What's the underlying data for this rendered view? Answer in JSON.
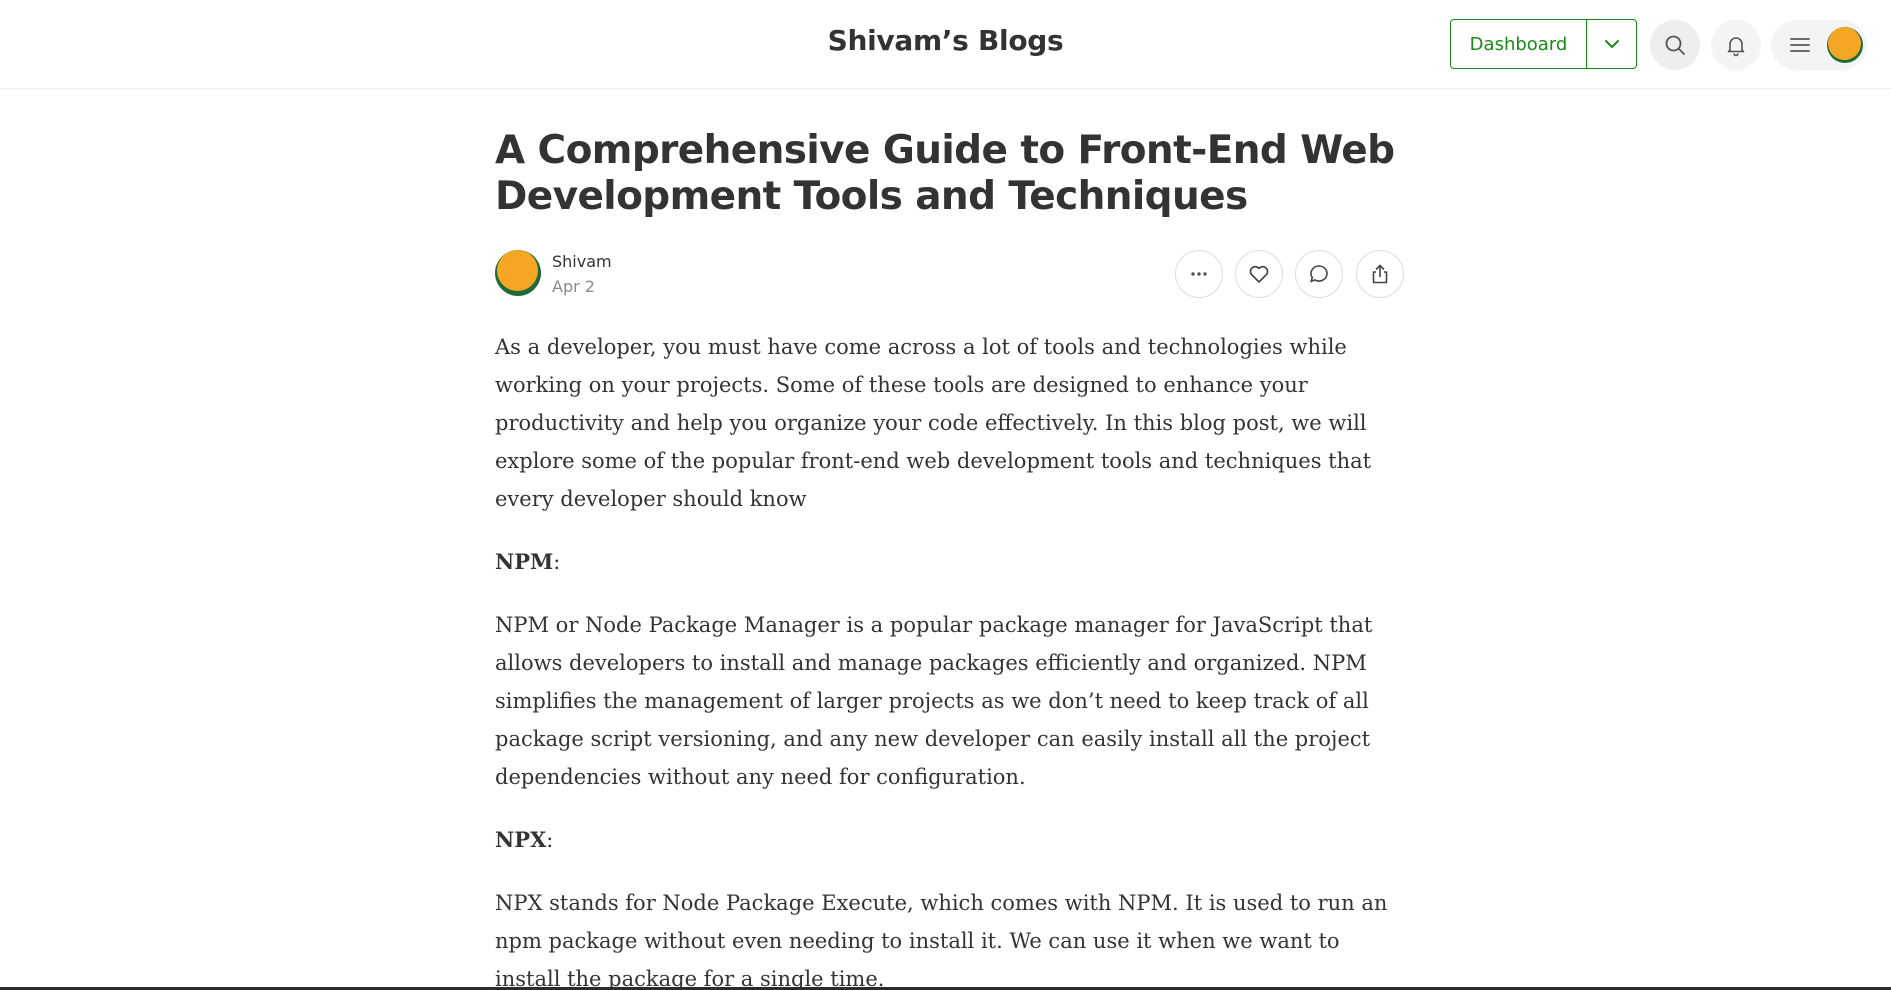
{
  "header": {
    "blog_title": "Shivam’s Blogs",
    "dashboard_label": "Dashboard",
    "accent_color": "#1a8917"
  },
  "article": {
    "title": "A Comprehensive Guide to Front-End Web Development Tools and Techniques",
    "author": "Shivam",
    "date": "Apr 2",
    "paragraphs": [
      {
        "kind": "text",
        "text": "As a developer, you must have come across a lot of tools and technologies while working on your projects. Some of these tools are designed to enhance your productivity and help you organize your code effectively. In this blog post, we will explore some of the popular front-end web development tools and techniques that every developer should know"
      },
      {
        "kind": "heading",
        "strong": "NPM",
        "rest": ":"
      },
      {
        "kind": "text",
        "text": "NPM or Node Package Manager is a popular package manager for JavaScript that allows developers to install and manage packages efficiently and organized. NPM simplifies the management of larger projects as we don’t need to keep track of all package script versioning, and any new developer can easily install all the project dependencies without any need for configuration."
      },
      {
        "kind": "heading",
        "strong": "NPX",
        "rest": ":"
      },
      {
        "kind": "text",
        "text": "NPX stands for Node Package Execute, which comes with NPM. It is used to run an npm package without even needing to install it. We can use it when we want to install the package for a single time."
      }
    ]
  },
  "icons": {
    "dashboard_caret": "chevron-down-icon",
    "search": "search-icon",
    "notifications": "bell-icon",
    "menu": "hamburger-icon",
    "more": "more-horizontal-icon",
    "like": "heart-icon",
    "comment": "comment-icon",
    "share": "share-icon"
  }
}
